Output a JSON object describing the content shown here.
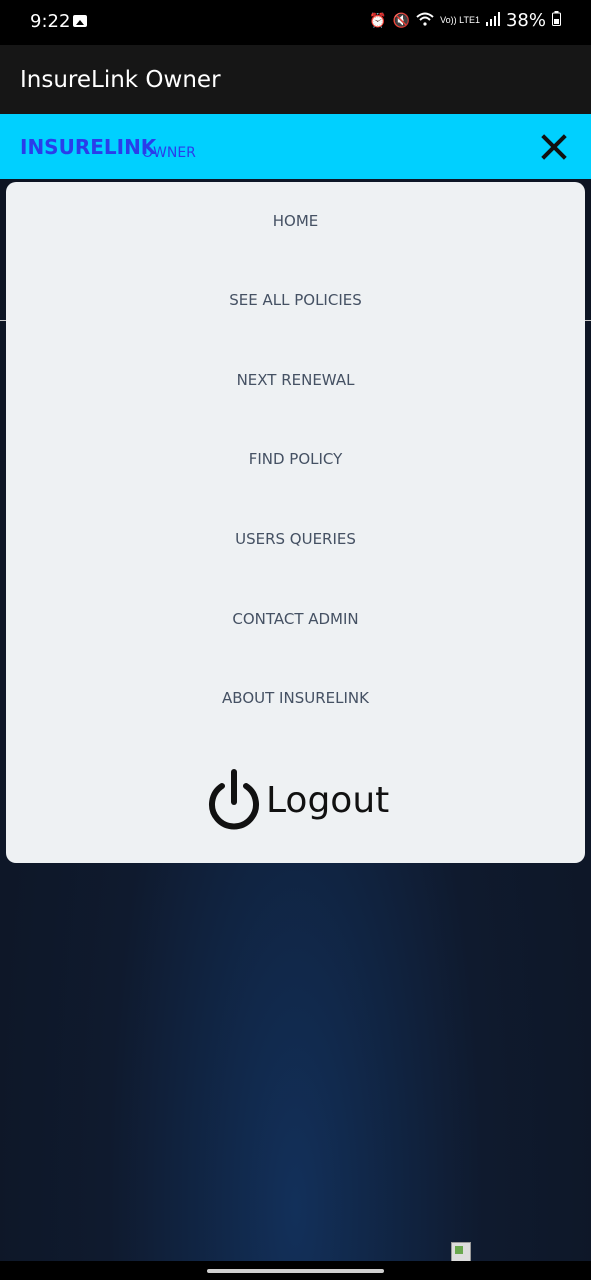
{
  "status_bar": {
    "time": "9:22",
    "lte_label": "Vo)) LTE1",
    "battery_percent": "38%"
  },
  "app_bar": {
    "title": "InsureLink Owner"
  },
  "nav_header": {
    "brand": "INSURELINK",
    "sub": "OWNER"
  },
  "menu": {
    "items": [
      {
        "label": "HOME"
      },
      {
        "label": "SEE ALL POLICIES"
      },
      {
        "label": "NEXT RENEWAL"
      },
      {
        "label": "FIND POLICY"
      },
      {
        "label": "USERS QUERIES"
      },
      {
        "label": "CONTACT ADMIN"
      },
      {
        "label": "ABOUT INSURELINK"
      }
    ],
    "logout_label": "Logout"
  },
  "colors": {
    "header_bg": "#00d0ff",
    "brand_text": "#2a3eea",
    "menu_bg": "#eef1f3",
    "menu_text": "#455163"
  },
  "icons": {
    "close": "close-icon",
    "logout": "power-icon",
    "gallery": "gallery-icon"
  }
}
